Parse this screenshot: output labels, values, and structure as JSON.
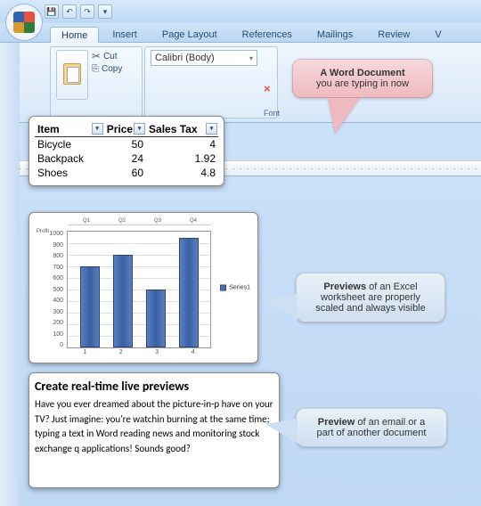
{
  "qat": {
    "save_tip": "💾",
    "undo_tip": "↶",
    "redo_tip": "↷",
    "more_tip": "▾"
  },
  "tabs": {
    "home": "Home",
    "insert": "Insert",
    "page_layout": "Page Layout",
    "references": "References",
    "mailings": "Mailings",
    "review": "Review",
    "view_initial": "V"
  },
  "ribbon": {
    "paste_label": "Paste",
    "cut_label": "Cut",
    "copy_label": "Copy",
    "font_name": "Calibri (Body)",
    "font_group_label": "Font"
  },
  "callouts": {
    "c1_bold": "A Word Document",
    "c1_rest": "you are typing in now",
    "c2_bold": "Previews",
    "c2_rest": " of an Excel worksheet are properly scaled and always visible",
    "c3_bold": "Preview",
    "c3_rest": " of an email or a part of another document"
  },
  "table_preview": {
    "h_item": "Item",
    "h_price": "Price",
    "h_tax": "Sales Tax",
    "rows": [
      {
        "item": "Bicycle",
        "price": "50",
        "tax": "4"
      },
      {
        "item": "Backpack",
        "price": "24",
        "tax": "1.92"
      },
      {
        "item": "Shoes",
        "price": "60",
        "tax": "4.8"
      }
    ]
  },
  "chart_data": {
    "type": "bar",
    "title_row_label": "Profit",
    "header_cells": [
      "Q1",
      "Q2",
      "Q3",
      "Q4"
    ],
    "header_values": [
      "700",
      "800",
      "500",
      "950"
    ],
    "categories": [
      "1",
      "2",
      "3",
      "4"
    ],
    "values": [
      700,
      800,
      500,
      950
    ],
    "ylim": [
      0,
      1000
    ],
    "y_ticks": [
      "1000",
      "900",
      "800",
      "700",
      "600",
      "500",
      "400",
      "300",
      "200",
      "100",
      "0"
    ],
    "legend": "Series1"
  },
  "doc_preview": {
    "heading": "Create real-time live previews",
    "body": "Have you ever dreamed about the picture-in-p have on your TV? Just imagine: you're watchin burning at the same time; typing a text in Word reading news and monitoring stock exchange q applications! Sounds good?"
  },
  "icons": {
    "dropdown": "▾",
    "x_close": "×"
  }
}
